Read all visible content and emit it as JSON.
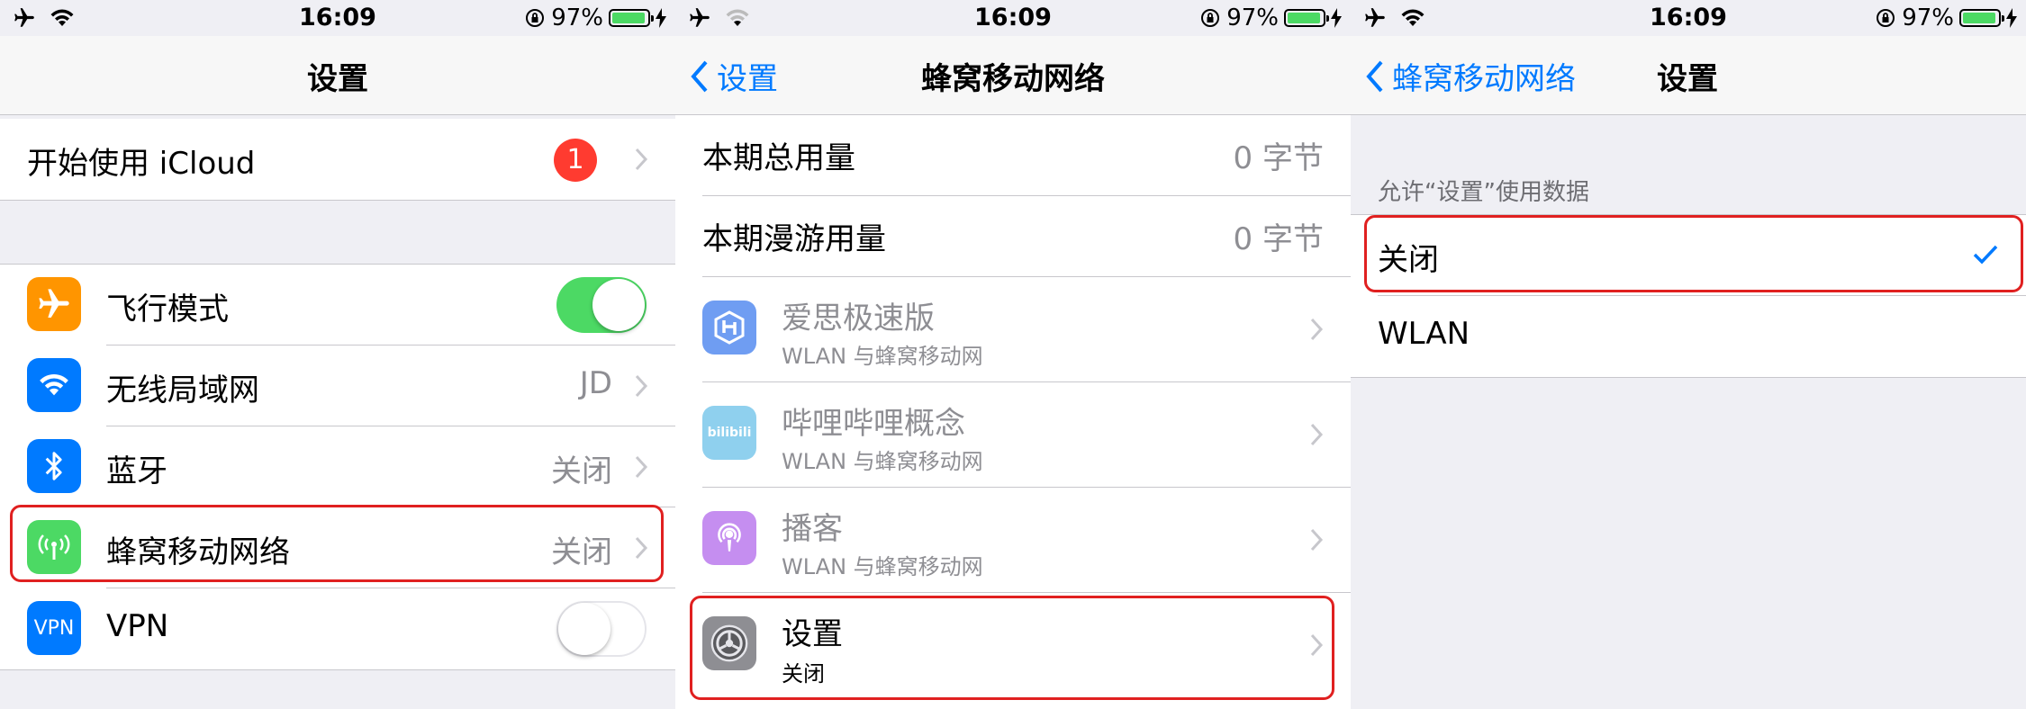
{
  "status_bar": {
    "time": "16:09",
    "battery_percent": "97%",
    "battery_level": 0.97
  },
  "screen1": {
    "title": "设置",
    "icloud": {
      "label": "开始使用 iCloud",
      "badge": "1"
    },
    "rows": [
      {
        "label": "飞行模式",
        "icon": "airplane-icon",
        "toggle": true
      },
      {
        "label": "无线局域网",
        "icon": "wifi-icon",
        "value": "JD"
      },
      {
        "label": "蓝牙",
        "icon": "bluetooth-icon",
        "value": "关闭"
      },
      {
        "label": "蜂窝移动网络",
        "icon": "cellular-icon",
        "value": "关闭"
      },
      {
        "label": "VPN",
        "icon": "vpn-icon",
        "icon_text": "VPN",
        "toggle": false
      }
    ]
  },
  "screen2": {
    "back_label": "设置",
    "title": "蜂窝移动网络",
    "usage_rows": [
      {
        "label": "本期总用量",
        "value": "0 字节"
      },
      {
        "label": "本期漫游用量",
        "value": "0 字节"
      }
    ],
    "apps": [
      {
        "name": "爱思极速版",
        "subtitle": "WLAN 与蜂窝移动网",
        "icon": "i4-app-icon"
      },
      {
        "name": "哔哩哔哩概念",
        "subtitle": "WLAN 与蜂窝移动网",
        "icon": "bilibili-app-icon",
        "icon_text": "bilibili"
      },
      {
        "name": "播客",
        "subtitle": "WLAN 与蜂窝移动网",
        "icon": "podcasts-app-icon"
      },
      {
        "name": "设置",
        "subtitle": "关闭",
        "icon": "settings-app-icon"
      }
    ]
  },
  "screen3": {
    "back_label": "蜂窝移动网络",
    "title": "设置",
    "section_header": "允许“设置”使用数据",
    "options": [
      {
        "label": "关闭",
        "selected": true
      },
      {
        "label": "WLAN",
        "selected": false
      }
    ]
  },
  "colors": {
    "accent": "#007aff",
    "toggle_on": "#4cd964",
    "badge": "#ff3b30",
    "highlight": "#e02020",
    "airplane": "#ff9500",
    "wifi": "#007aff",
    "bluetooth": "#007aff",
    "cellular": "#4cd964",
    "vpn": "#007aff"
  }
}
